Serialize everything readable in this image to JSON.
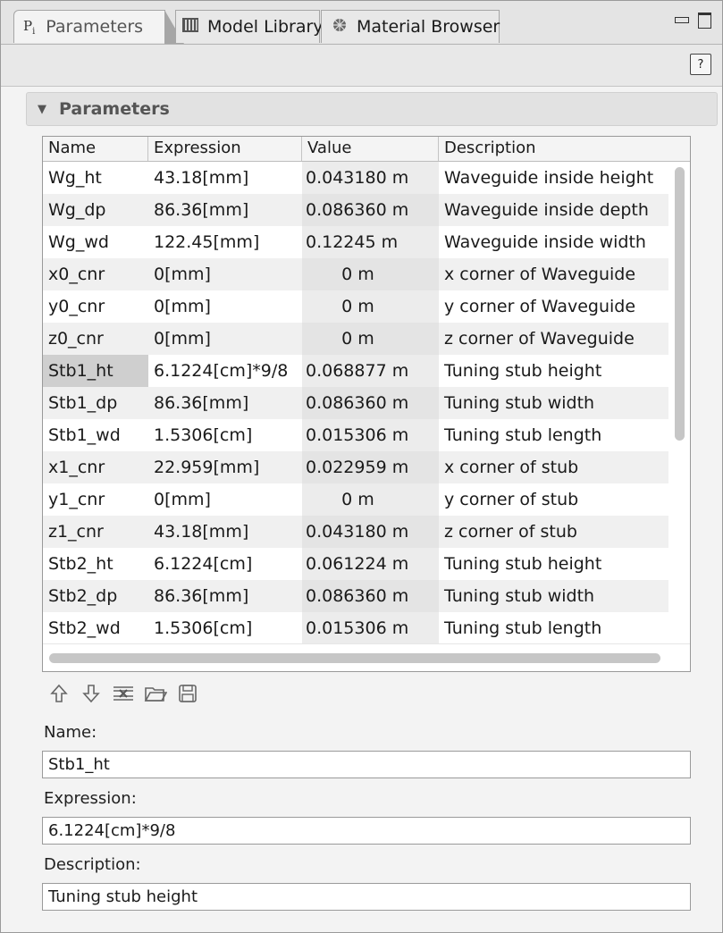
{
  "tabs": [
    {
      "icon": "P",
      "icon_sub": "i",
      "label": "Parameters",
      "active": true
    },
    {
      "label": "Model Library",
      "active": false
    },
    {
      "label": "Material Browser",
      "active": false
    }
  ],
  "section": {
    "title": "Parameters"
  },
  "table": {
    "columns": [
      "Name",
      "Expression",
      "Value",
      "Description"
    ],
    "rows": [
      [
        "Wg_ht",
        "43.18[mm]",
        "0.043180 m",
        "Waveguide inside height"
      ],
      [
        "Wg_dp",
        "86.36[mm]",
        "0.086360 m",
        "Waveguide inside depth"
      ],
      [
        "Wg_wd",
        "122.45[mm]",
        "0.12245 m",
        "Waveguide inside width"
      ],
      [
        "x0_cnr",
        "0[mm]",
        "0 m",
        "x corner of Waveguide"
      ],
      [
        "y0_cnr",
        "0[mm]",
        "0 m",
        "y corner of Waveguide"
      ],
      [
        "z0_cnr",
        "0[mm]",
        "0 m",
        "z corner of Waveguide"
      ],
      [
        "Stb1_ht",
        "6.1224[cm]*9/8",
        "0.068877 m",
        "Tuning stub height"
      ],
      [
        "Stb1_dp",
        "86.36[mm]",
        "0.086360 m",
        "Tuning stub width"
      ],
      [
        "Stb1_wd",
        "1.5306[cm]",
        "0.015306 m",
        "Tuning stub length"
      ],
      [
        "x1_cnr",
        "22.959[mm]",
        "0.022959 m",
        "x corner of stub"
      ],
      [
        "y1_cnr",
        "0[mm]",
        "0 m",
        "y corner of stub"
      ],
      [
        "z1_cnr",
        "43.18[mm]",
        "0.043180 m",
        "z corner of stub"
      ],
      [
        "Stb2_ht",
        "6.1224[cm]",
        "0.061224 m",
        "Tuning stub height"
      ],
      [
        "Stb2_dp",
        "86.36[mm]",
        "0.086360 m",
        "Tuning stub width"
      ],
      [
        "Stb2_wd",
        "1.5306[cm]",
        "0.015306 m",
        "Tuning stub length"
      ]
    ],
    "selected_row": 6
  },
  "form": {
    "name_label": "Name:",
    "name_value": "Stb1_ht",
    "expression_label": "Expression:",
    "expression_value": "6.1224[cm]*9/8",
    "description_label": "Description:",
    "description_value": "Tuning stub height"
  }
}
